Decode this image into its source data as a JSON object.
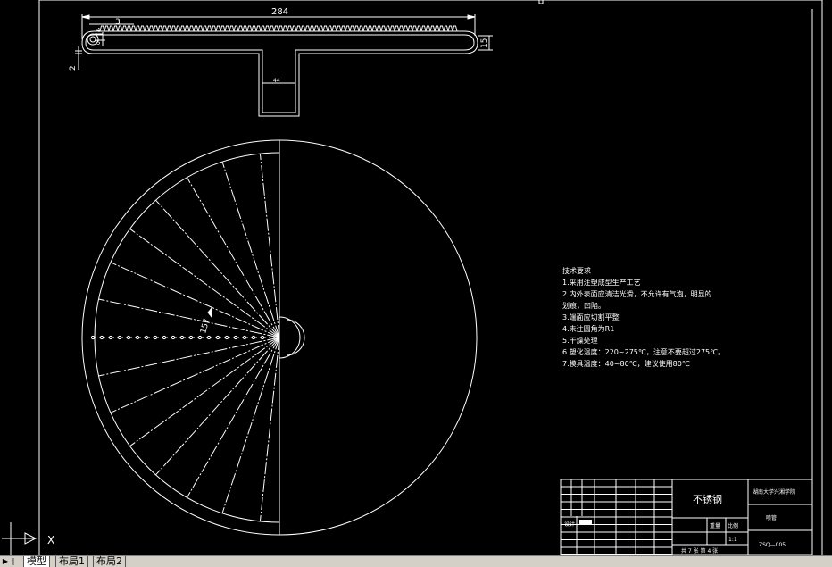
{
  "dimensions": {
    "overall_length": "284",
    "tooth_pitch": "3",
    "small_a": "4",
    "small_b": "5",
    "end_height": "15",
    "wall": "2",
    "stem": "44",
    "radial": "157"
  },
  "tech_requirements": {
    "heading": "技术要求",
    "lines": [
      "1.采用注塑成型生产工艺",
      "2.内外表面应清洁光滑，不允许有气泡，明显的",
      "划痕，凹陷。",
      "3.端面应切割平整",
      "4.未注圆角为R1",
      "5.干燥处理",
      "6.塑化温度：220~275℃，注意不要超过275℃。",
      "7.模具温度：40~80℃，建议使用80℃"
    ]
  },
  "title_block": {
    "material": "不锈钢",
    "school": "湖南大学兴湘学院",
    "part_name": "喷管",
    "design_label": "设计",
    "weight_label": "重量",
    "scale_label": "比例",
    "scale_value": "1:1",
    "sheet_info": "共 7 张  第 4 张",
    "drawing_no": "ZSQ—005"
  },
  "ucs": {
    "x_label": "X"
  },
  "tabs": {
    "items": [
      {
        "label": "模型",
        "active": true
      },
      {
        "label": "布局1",
        "active": false
      },
      {
        "label": "布局2",
        "active": false
      }
    ]
  },
  "colors": {
    "background": "#000000",
    "lines": "#ffffff",
    "tabbar": "#d4d0c8"
  }
}
